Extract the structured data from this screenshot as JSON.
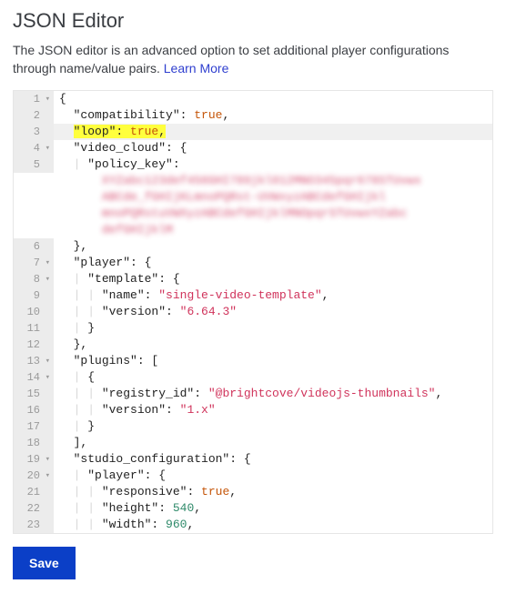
{
  "title": "JSON Editor",
  "description": "The JSON editor is an advanced option to set additional player configurations through name/value pairs. ",
  "learn_more": "Learn More",
  "save_label": "Save",
  "code": {
    "line1": "{",
    "compat_key": "\"compatibility\"",
    "compat_val": "true",
    "loop_key": "\"loop\"",
    "loop_val": "true",
    "video_cloud_key": "\"video_cloud\"",
    "policy_key": "\"policy_key\"",
    "redacted1": "XYZabc123def456GHI789jkl012MNO345pqr678STUvwx",
    "redacted2": "ABCde_fGHIjKLmnoPQRst-UVWxyzABCdefGHIjkl",
    "redacted3": "mnoPQRstuVWXyzABCdefGHIjklMNOpqrSTUvwxYZabc",
    "redacted4": "defGHIjklM",
    "player_key": "\"player\"",
    "template_key": "\"template\"",
    "name_key": "\"name\"",
    "name_val": "\"single-video-template\"",
    "version_key": "\"version\"",
    "version_val": "\"6.64.3\"",
    "plugins_key": "\"plugins\"",
    "registry_key": "\"registry_id\"",
    "registry_val": "\"@brightcove/videojs-thumbnails\"",
    "plugin_version_val": "\"1.x\"",
    "studio_key": "\"studio_configuration\"",
    "responsive_key": "\"responsive\"",
    "responsive_val": "true",
    "height_key": "\"height\"",
    "height_val": "540",
    "width_key": "\"width\"",
    "width_val": "960"
  }
}
